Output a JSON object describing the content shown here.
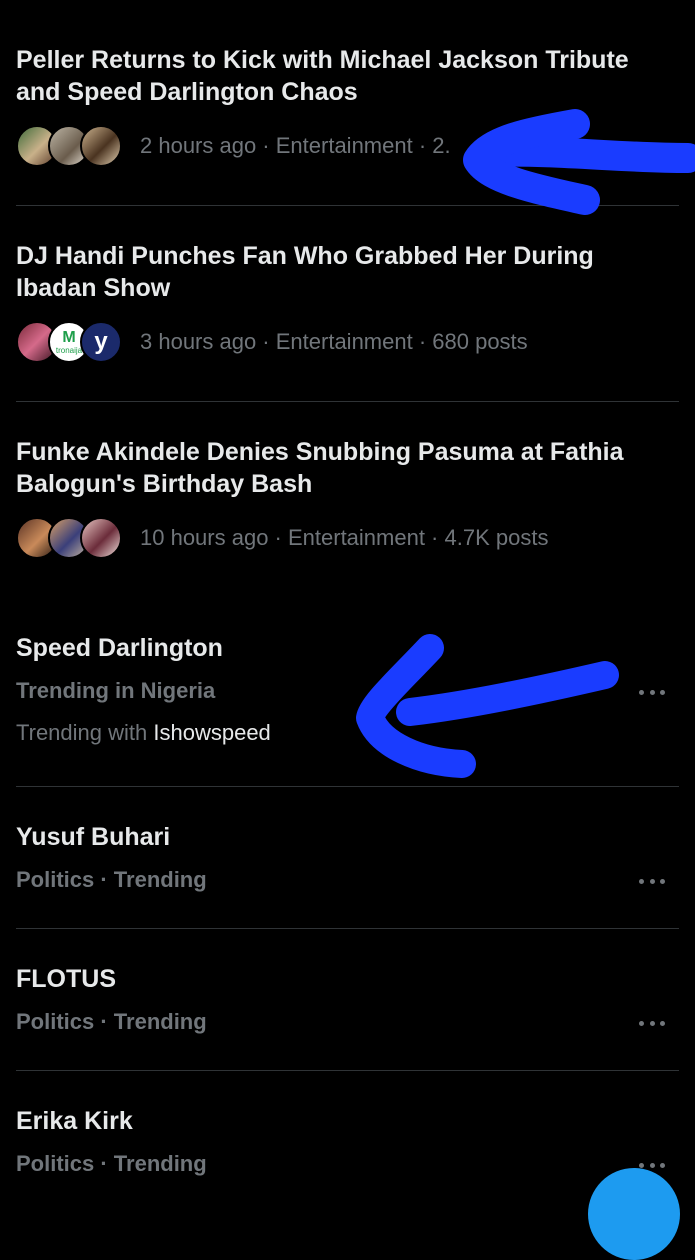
{
  "news": [
    {
      "title_line1": "Peller Returns to Kick with Michael Jackson Tribute",
      "title_line2": "and Speed Darlington Chaos",
      "meta": "2 hours ago · Entertainment · 2.",
      "avatar_icons": [
        "person-photo-icon",
        "person-photo-icon",
        "person-photo-icon"
      ]
    },
    {
      "title_line1": "DJ Handi Punches Fan Who Grabbed Her During",
      "title_line2": "Ibadan Show",
      "meta": "3 hours ago · Entertainment · 680 posts",
      "avatar_icons": [
        "person-photo-icon",
        "m-logo-icon",
        "y-logo-icon"
      ],
      "avatar_texts": [
        "M",
        "tronaija",
        "y"
      ]
    },
    {
      "title_line1": "Funke Akindele Denies Snubbing Pasuma at Fathia",
      "title_line2": "Balogun's Birthday Bash",
      "meta": "10 hours ago · Entertainment · 4.7K posts",
      "avatar_icons": [
        "person-photo-icon",
        "person-photo-icon",
        "person-photo-icon"
      ]
    }
  ],
  "trends": [
    {
      "title": "Speed Darlington",
      "sub": "Trending in Nigeria",
      "with_label": "Trending with",
      "with_value": "Ishowspeed"
    },
    {
      "title": "Yusuf Buhari",
      "sub": "Politics · Trending"
    },
    {
      "title": "FLOTUS",
      "sub": "Politics · Trending"
    },
    {
      "title": "Erika Kirk",
      "sub": "Politics · Trending"
    }
  ],
  "colors": {
    "background": "#000000",
    "text_primary": "#e7e9ea",
    "text_secondary": "#71767b",
    "divider": "#2f3336",
    "annotation_arrow": "#1a3cff",
    "fab": "#1d9bf0"
  },
  "icons": {
    "more": "more-horizontal-icon",
    "annotation": "hand-drawn-arrow-icon"
  }
}
